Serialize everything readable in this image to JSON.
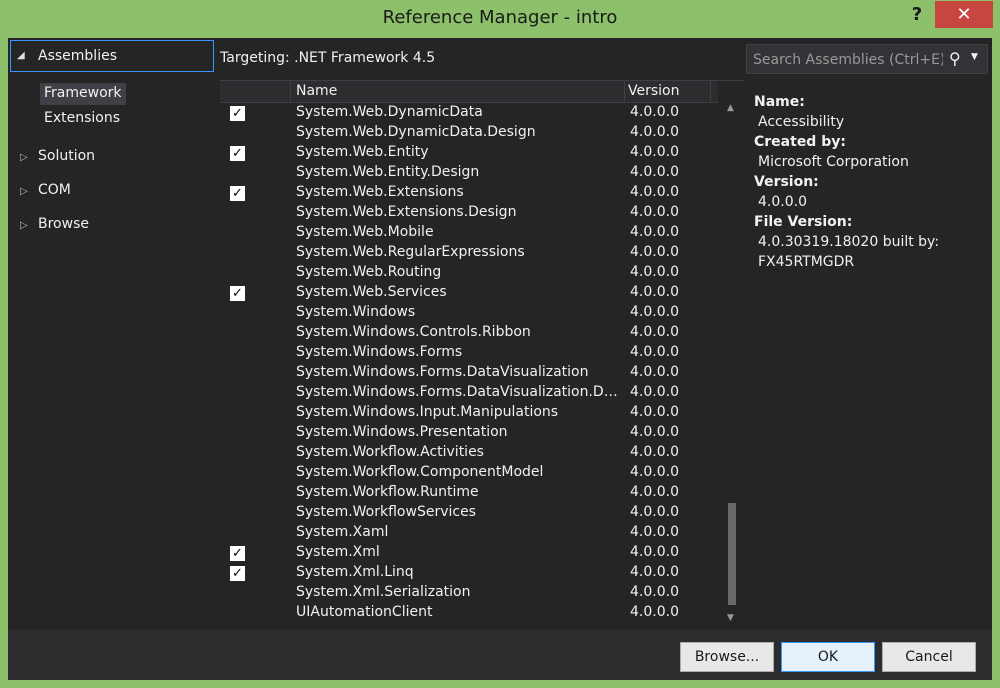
{
  "window": {
    "title": "Reference Manager - intro",
    "help_label": "?",
    "close_label": "✕"
  },
  "nav": {
    "assemblies": "Assemblies",
    "framework": "Framework",
    "extensions": "Extensions",
    "solution": "Solution",
    "com": "COM",
    "browse": "Browse"
  },
  "targeting": "Targeting: .NET Framework 4.5",
  "grid": {
    "col_name": "Name",
    "col_version": "Version",
    "rows": [
      {
        "checked": true,
        "name": "System.Web.DynamicData",
        "version": "4.0.0.0"
      },
      {
        "checked": false,
        "name": "System.Web.DynamicData.Design",
        "version": "4.0.0.0"
      },
      {
        "checked": true,
        "name": "System.Web.Entity",
        "version": "4.0.0.0"
      },
      {
        "checked": false,
        "name": "System.Web.Entity.Design",
        "version": "4.0.0.0"
      },
      {
        "checked": true,
        "name": "System.Web.Extensions",
        "version": "4.0.0.0"
      },
      {
        "checked": false,
        "name": "System.Web.Extensions.Design",
        "version": "4.0.0.0"
      },
      {
        "checked": false,
        "name": "System.Web.Mobile",
        "version": "4.0.0.0"
      },
      {
        "checked": false,
        "name": "System.Web.RegularExpressions",
        "version": "4.0.0.0"
      },
      {
        "checked": false,
        "name": "System.Web.Routing",
        "version": "4.0.0.0"
      },
      {
        "checked": true,
        "name": "System.Web.Services",
        "version": "4.0.0.0"
      },
      {
        "checked": false,
        "name": "System.Windows",
        "version": "4.0.0.0"
      },
      {
        "checked": false,
        "name": "System.Windows.Controls.Ribbon",
        "version": "4.0.0.0"
      },
      {
        "checked": false,
        "name": "System.Windows.Forms",
        "version": "4.0.0.0"
      },
      {
        "checked": false,
        "name": "System.Windows.Forms.DataVisualization",
        "version": "4.0.0.0"
      },
      {
        "checked": false,
        "name": "System.Windows.Forms.DataVisualization.Desi...",
        "version": "4.0.0.0"
      },
      {
        "checked": false,
        "name": "System.Windows.Input.Manipulations",
        "version": "4.0.0.0"
      },
      {
        "checked": false,
        "name": "System.Windows.Presentation",
        "version": "4.0.0.0"
      },
      {
        "checked": false,
        "name": "System.Workflow.Activities",
        "version": "4.0.0.0"
      },
      {
        "checked": false,
        "name": "System.Workflow.ComponentModel",
        "version": "4.0.0.0"
      },
      {
        "checked": false,
        "name": "System.Workflow.Runtime",
        "version": "4.0.0.0"
      },
      {
        "checked": false,
        "name": "System.WorkflowServices",
        "version": "4.0.0.0"
      },
      {
        "checked": false,
        "name": "System.Xaml",
        "version": "4.0.0.0"
      },
      {
        "checked": true,
        "name": "System.Xml",
        "version": "4.0.0.0"
      },
      {
        "checked": true,
        "name": "System.Xml.Linq",
        "version": "4.0.0.0"
      },
      {
        "checked": false,
        "name": "System.Xml.Serialization",
        "version": "4.0.0.0"
      },
      {
        "checked": false,
        "name": "UIAutomationClient",
        "version": "4.0.0.0"
      }
    ]
  },
  "search": {
    "placeholder": "Search Assemblies (Ctrl+E)"
  },
  "details": {
    "name_label": "Name:",
    "name_value": "Accessibility",
    "created_label": "Created by:",
    "created_value": "Microsoft Corporation",
    "version_label": "Version:",
    "version_value": "4.0.0.0",
    "file_version_label": "File Version:",
    "file_version_value_1": "4.0.30319.18020 built by:",
    "file_version_value_2": "FX45RTMGDR"
  },
  "buttons": {
    "browse": "Browse...",
    "ok": "OK",
    "cancel": "Cancel"
  }
}
